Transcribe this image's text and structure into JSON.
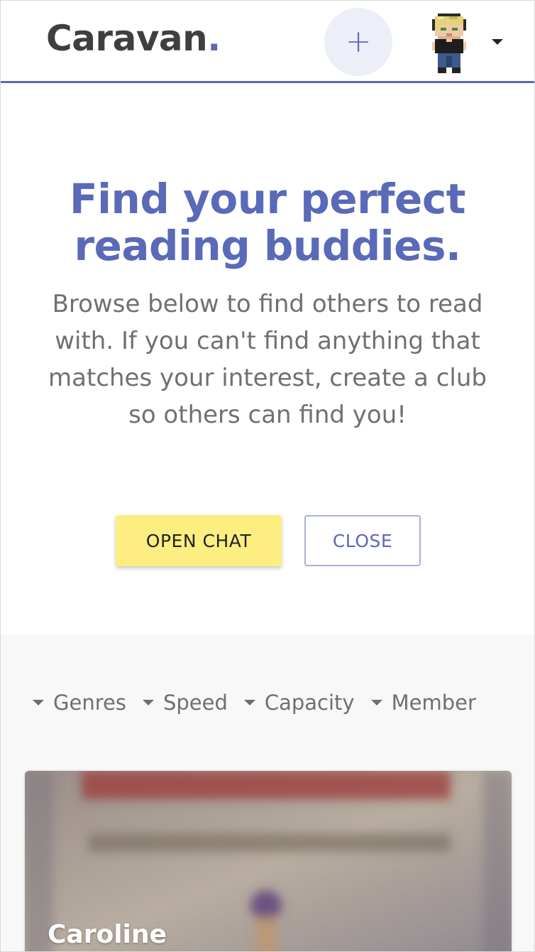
{
  "header": {
    "logo_text": "Caravan",
    "logo_dot": ".",
    "add_label": "+"
  },
  "hero": {
    "title": "Find your perfect reading buddies.",
    "subtitle": "Browse below to find others to read with. If you can't find anything that matches your interest, create a club so others can find you!",
    "open_chat_label": "OPEN CHAT",
    "close_label": "CLOSE"
  },
  "filters": [
    {
      "label": "Genres"
    },
    {
      "label": "Speed"
    },
    {
      "label": "Capacity"
    },
    {
      "label": "Member"
    }
  ],
  "clubs": [
    {
      "name": "Caroline"
    }
  ],
  "colors": {
    "accent": "#5a6ab8",
    "chat_button": "#fdee82",
    "section_bg": "#f8f8f8"
  },
  "icons": [
    "plus-icon",
    "user-avatar",
    "caret-down-icon"
  ]
}
